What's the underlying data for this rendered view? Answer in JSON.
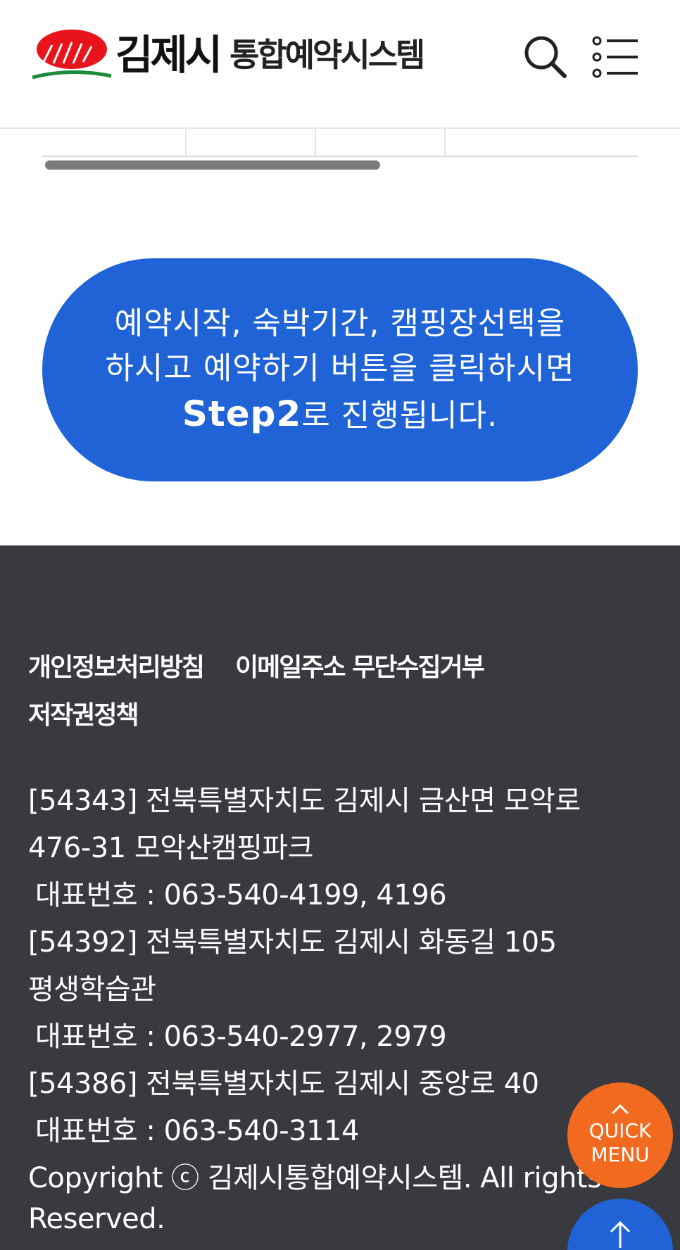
{
  "header": {
    "logo_city": "김제시",
    "logo_system": "통합예약시스템"
  },
  "notice": {
    "line1": "예약시작, 숙박기간, 캠핑장선택을",
    "line2": "하시고 예약하기 버튼을 클릭하시면",
    "step": "Step2",
    "line3_rest": "로 진행됩니다."
  },
  "footer": {
    "links": [
      "개인정보처리방침",
      "이메일주소 무단수집거부",
      "저작권정책"
    ],
    "info": [
      "[54343] 전북특별자치도 김제시 금산면 모악로",
      "476-31 모악산캠핑파크",
      "대표번호 : 063-540-4199, 4196",
      "[54392] 전북특별자치도 김제시 화동길 105",
      "평생학습관",
      "대표번호 : 063-540-2977, 2979",
      "[54386] 전북특별자치도 김제시 중앙로 40",
      "대표번호 : 063-540-3114"
    ],
    "copyright": "Copyright ⓒ 김제시통합예약시스템. All rights Reserved."
  },
  "floating": {
    "quick_menu_line1": "QUICK",
    "quick_menu_line2": "MENU"
  },
  "colors": {
    "brand_blue": "#1f63d6",
    "footer_bg": "#383a40",
    "quick_orange": "#f26a1f",
    "logo_red": "#e8141c",
    "logo_green": "#1b8a3a"
  }
}
